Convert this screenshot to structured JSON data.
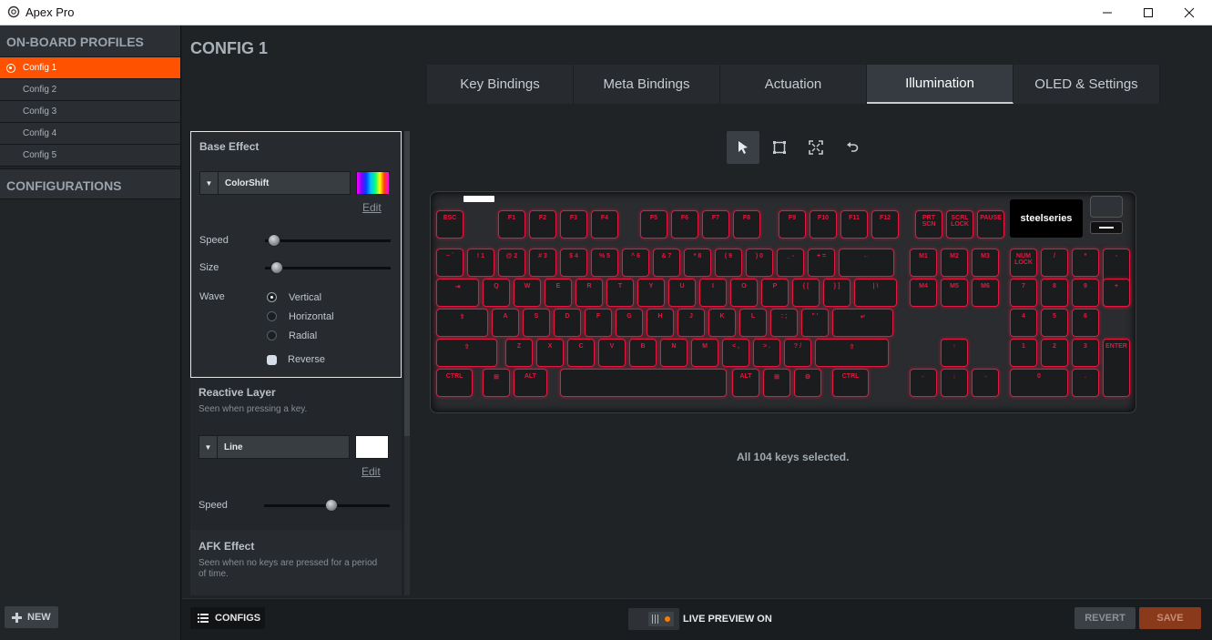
{
  "window": {
    "title": "Apex Pro",
    "controls": [
      "minimize",
      "maximize",
      "close"
    ]
  },
  "sidebar": {
    "profiles_heading": "ON-BOARD PROFILES",
    "items": [
      {
        "label": "Config 1",
        "active": true
      },
      {
        "label": "Config 2",
        "active": false
      },
      {
        "label": "Config 3",
        "active": false
      },
      {
        "label": "Config 4",
        "active": false
      },
      {
        "label": "Config 5",
        "active": false
      }
    ],
    "configurations_heading": "CONFIGURATIONS",
    "new_button": "NEW"
  },
  "main": {
    "title": "CONFIG 1",
    "tabs": [
      {
        "label": "Key Bindings",
        "active": false
      },
      {
        "label": "Meta Bindings",
        "active": false
      },
      {
        "label": "Actuation",
        "active": false
      },
      {
        "label": "Illumination",
        "active": true
      },
      {
        "label": "OLED & Settings",
        "active": false
      }
    ]
  },
  "base_effect": {
    "title": "Base Effect",
    "effect": "ColorShift",
    "edit": "Edit",
    "speed_label": "Speed",
    "speed_value": 0.05,
    "size_label": "Size",
    "size_value": 0.1,
    "wave_label": "Wave",
    "wave_options": [
      "Vertical",
      "Horizontal",
      "Radial"
    ],
    "wave_selected": "Vertical",
    "reverse_label": "Reverse",
    "reverse_checked": false
  },
  "reactive_layer": {
    "title": "Reactive Layer",
    "subtitle": "Seen when pressing a key.",
    "effect": "Line",
    "edit": "Edit",
    "speed_label": "Speed",
    "speed_value": 0.5,
    "color": "#ffffff"
  },
  "afk_effect": {
    "title": "AFK Effect",
    "subtitle": "Seen when no keys are pressed for a period of time."
  },
  "tools": [
    "select-pointer-icon",
    "box-select-icon",
    "select-all-icon",
    "undo-icon"
  ],
  "keyboard": {
    "logo": "steelseries",
    "rows": [
      [
        "ESC",
        "F1",
        "F2",
        "F3",
        "F4",
        "F5",
        "F6",
        "F7",
        "F8",
        "F9",
        "F10",
        "F11",
        "F12",
        "PRT SCN",
        "SCRL LOCK",
        "PAUSE"
      ],
      [
        "~ `",
        "! 1",
        "@ 2",
        "# 3",
        "$ 4",
        "% 5",
        "^ 6",
        "& 7",
        "* 8",
        "( 9",
        ") 0",
        "_ -",
        "+ =",
        "←",
        "M1",
        "M2",
        "M3",
        "NUM LOCK",
        "/",
        "*",
        "-"
      ],
      [
        "⇥",
        "Q",
        "W",
        "E",
        "R",
        "T",
        "Y",
        "U",
        "I",
        "O",
        "P",
        "{ [",
        "} ]",
        "| \\",
        "M4",
        "M5",
        "M6",
        "7",
        "8",
        "9",
        "+"
      ],
      [
        "⇪",
        "A",
        "S",
        "D",
        "F",
        "G",
        "H",
        "J",
        "K",
        "L",
        ": ;",
        "\" '",
        "↵",
        "4",
        "5",
        "6"
      ],
      [
        "⇧",
        "Z",
        "X",
        "C",
        "V",
        "B",
        "N",
        "M",
        "< ,",
        "> .",
        "? /",
        "⇧",
        "↑",
        "1",
        "2",
        "3",
        "ENTER"
      ],
      [
        "CTRL",
        "⊞",
        "ALT",
        "",
        "ALT",
        "⊞",
        "⚙",
        "CTRL",
        "←",
        "↓",
        "→",
        "0",
        "."
      ]
    ]
  },
  "selection_info": "All 104 keys selected.",
  "bottom": {
    "configs_button": "CONFIGS",
    "live_preview": "LIVE PREVIEW ON",
    "revert": "REVERT",
    "save": "SAVE"
  },
  "colors": {
    "accent": "#ff5200",
    "key_glow": "#e2183f",
    "save_bg": "#8a3a1a"
  }
}
